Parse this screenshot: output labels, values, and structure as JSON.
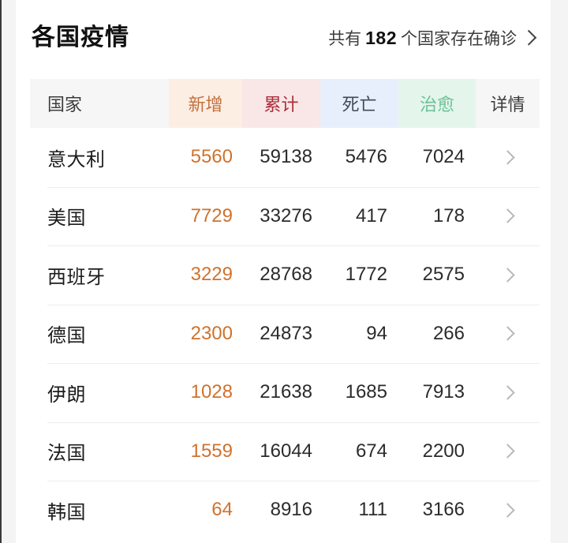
{
  "header": {
    "title": "各国疫情",
    "link_prefix": "共有",
    "link_count": "182",
    "link_suffix": "个国家存在确诊",
    "chevron_icon": "chevron-right-icon"
  },
  "table": {
    "columns": [
      {
        "key": "country",
        "label": "国家",
        "accent": "#3d3d3d",
        "bg": "#f6f6f6"
      },
      {
        "key": "new",
        "label": "新增",
        "accent": "#c2713f",
        "bg": "#fdeee4"
      },
      {
        "key": "total",
        "label": "累计",
        "accent": "#ab2f39",
        "bg": "#f9e7e8"
      },
      {
        "key": "death",
        "label": "死亡",
        "accent": "#3f4a5c",
        "bg": "#e7effc"
      },
      {
        "key": "cure",
        "label": "治愈",
        "accent": "#6cc295",
        "bg": "#e4f5ec"
      },
      {
        "key": "detail",
        "label": "详情",
        "accent": "#3d3d3d",
        "bg": "#f6f6f6"
      }
    ],
    "row_chevron_icon": "chevron-right-icon",
    "rows": [
      {
        "country": "意大利",
        "new": "5560",
        "total": "59138",
        "death": "5476",
        "cure": "7024"
      },
      {
        "country": "美国",
        "new": "7729",
        "total": "33276",
        "death": "417",
        "cure": "178"
      },
      {
        "country": "西班牙",
        "new": "3229",
        "total": "28768",
        "death": "1772",
        "cure": "2575"
      },
      {
        "country": "德国",
        "new": "2300",
        "total": "24873",
        "death": "94",
        "cure": "266"
      },
      {
        "country": "伊朗",
        "new": "1028",
        "total": "21638",
        "death": "1685",
        "cure": "7913"
      },
      {
        "country": "法国",
        "new": "1559",
        "total": "16044",
        "death": "674",
        "cure": "2200"
      },
      {
        "country": "韩国",
        "new": "64",
        "total": "8916",
        "death": "111",
        "cure": "3166"
      }
    ]
  },
  "theme": {
    "new_value_color": "#d0722c",
    "value_color": "#2b2b2b",
    "separator_color": "#ececec",
    "page_bg": "#ffffff",
    "gutter_bg": "#f4f4f4"
  }
}
